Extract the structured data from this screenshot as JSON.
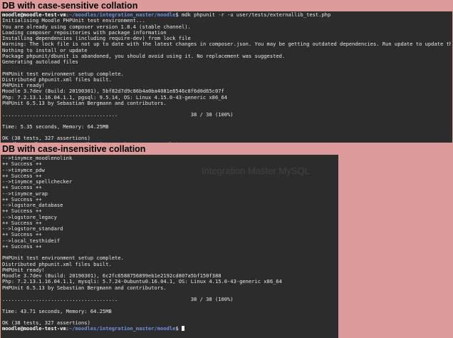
{
  "headings": {
    "sensitive": "DB with case-sensitive collation",
    "insensitive": "DB with case-insensitive collation"
  },
  "terminal1": {
    "prompt_user": "moodle@moodle-test-vm",
    "prompt_path": "~/moodles/integration_master/moodle",
    "command": "mdk phpunit -r -u user/tests/externallib_test.php",
    "lines": [
      "Initialising Moodle PHPUnit test environment...",
      "You are already using composer version 1.8.4 (stable channel).",
      "Loading composer repositories with package information",
      "Installing dependencies (including require-dev) from lock file",
      "Warning: The lock file is not up to date with the latest changes in composer.json. You may be getting outdated dependencies. Run update to update them.",
      "Nothing to install or update",
      "Package phpunit/dbunit is abandoned, you should avoid using it. No replacement was suggested.",
      "Generating autoload files",
      "",
      "PHPUnit test environment setup complete.",
      "Distributed phpunit.xml files built.",
      "PHPUnit ready!",
      "Moodle 3.7dev (Build: 20190301), 5bf82d7d9c86b4a0ba4081e8546c8f6d0d65c07f",
      "Php: 7.2.13.1.16.04.1.1, pgsql: 9.5.14, OS: Linux 4.15.0-43-generic x86_64",
      "PHPUnit 6.5.13 by Sebastian Bergmann and contributors.",
      "",
      "......................................                        38 / 38 (100%)",
      "",
      "Time: 5.35 seconds, Memory: 64.25MB",
      "",
      "OK (38 tests, 327 assertions)"
    ],
    "final_prompt_symbol": "$"
  },
  "terminal2": {
    "lines": [
      "-->tinymce_moodlenolink",
      "++ Success ++",
      "-->tinymce_pdw",
      "++ Success ++",
      "-->tinymce_spellchecker",
      "++ Success ++",
      "-->tinymce_wrap",
      "++ Success ++",
      "-->logstore_database",
      "++ Success ++",
      "-->logstore_legacy",
      "++ Success ++",
      "-->logstore_standard",
      "++ Success ++",
      "-->local_testhideif",
      "++ Success ++",
      "",
      "PHPUnit test environment setup complete.",
      "Distributed phpunit.xml files built.",
      "PHPUnit ready!",
      "Moodle 3.7dev (Build: 20190301), 6c2fc6588756899eb1e2192cd807a5bf150f388",
      "Php: 7.2.13.1.16.04.1.1, mysqli: 5.7.24-0ubuntu0.16.04.1, OS: Linux 4.15.0-43-generic x86_64",
      "PHPUnit 6.5.13 by Sebastian Bergmann and contributors.",
      "",
      "......................................                        38 / 38 (100%)",
      "",
      "Time: 43.71 seconds, Memory: 64.25MB",
      "",
      "OK (38 tests, 327 assertions)"
    ],
    "prompt_user": "moodle@moodle-test-vm",
    "prompt_path": "~/moodles/integration_master/moodle",
    "final_prompt_symbol": "$"
  },
  "background_ghost": {
    "title": "Integration Master MySQL"
  },
  "colors": {
    "page_background": "#dc9a9a",
    "terminal_background": "#2c2c2c",
    "terminal_text": "#e8e8e8",
    "prompt_path": "#6f8fe0"
  }
}
